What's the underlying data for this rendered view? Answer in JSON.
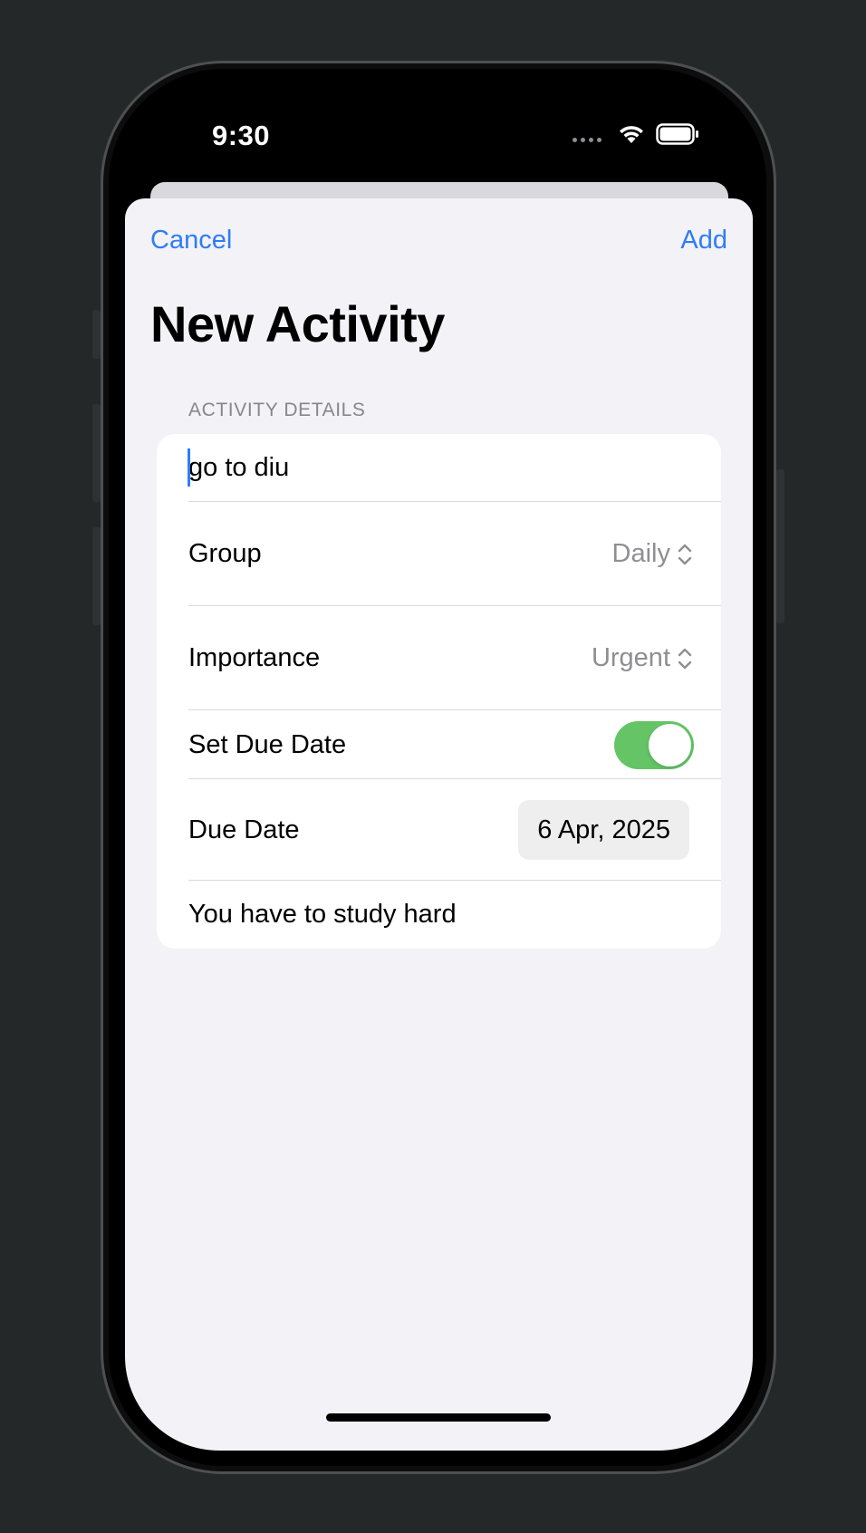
{
  "status_bar": {
    "time": "9:30",
    "icons": [
      "cellular-dots-icon",
      "wifi-icon",
      "battery-icon"
    ]
  },
  "nav": {
    "cancel_label": "Cancel",
    "add_label": "Add"
  },
  "page": {
    "title": "New Activity"
  },
  "section": {
    "header": "ACTIVITY DETAILS"
  },
  "form": {
    "activity_name": "go to diu",
    "group_label": "Group",
    "group_value": "Daily",
    "importance_label": "Importance",
    "importance_value": "Urgent",
    "due_toggle_label": "Set Due Date",
    "due_toggle_on": true,
    "due_date_label": "Due Date",
    "due_date_value": "6 Apr, 2025",
    "notes": "You have to study hard"
  },
  "colors": {
    "accent": "#2f7cf6",
    "toggle_on": "#65c466",
    "sheet_bg": "#f2f2f7",
    "secondary_text": "#8e8e93"
  }
}
